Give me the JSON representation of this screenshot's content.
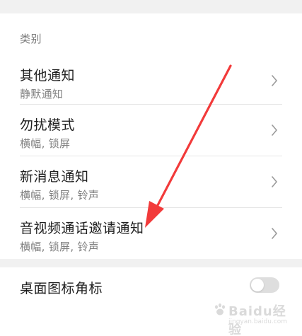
{
  "category_section": {
    "label": "类别",
    "items": [
      {
        "title": "其他通知",
        "subtitle": "静默通知"
      },
      {
        "title": "勿扰模式",
        "subtitle": "横幅, 锁屏"
      },
      {
        "title": "新消息通知",
        "subtitle": "横幅, 锁屏, 铃声"
      },
      {
        "title": "音视频通话邀请通知",
        "subtitle": "横幅, 锁屏, 铃声"
      }
    ]
  },
  "badge_setting": {
    "title": "桌面图标角标",
    "enabled": false
  },
  "icons": {
    "chevron": "chevron-right-icon",
    "annotation_arrow": "red-arrow-icon",
    "toggle": "toggle-switch"
  },
  "colors": {
    "annotation_arrow": "#f23a3a",
    "toggle_off": "#dedede",
    "divider": "#e6e6e6",
    "section_gap": "#f1f1f1"
  },
  "watermark": {
    "brand": "Baidu经验",
    "url": "jingyan.baidu.com"
  }
}
